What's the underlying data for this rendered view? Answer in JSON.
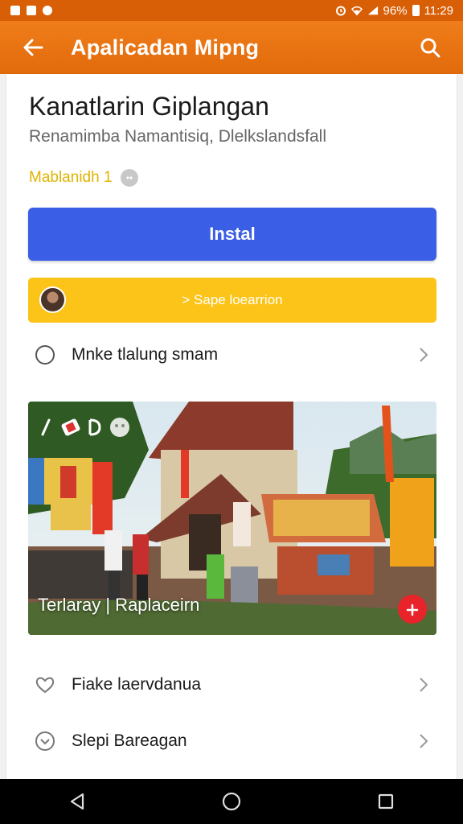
{
  "status_bar": {
    "battery": "96%",
    "time": "11:29",
    "icons": [
      "notification-icon",
      "notification-icon",
      "notification-icon",
      "alarm-icon",
      "wifi-icon",
      "signal-icon",
      "battery-icon"
    ]
  },
  "app_bar": {
    "title": "Apalicadan Mipng",
    "back_icon": "back-arrow-icon",
    "search_icon": "search-icon"
  },
  "app": {
    "title": "Kanatlarin Giplangan",
    "subtitle": "Renamimba Namantisiq, Dlelkslandsfall",
    "rating_label": "Mablanidh 1",
    "install_label": "Instal",
    "secondary_label": "> Sape loearrion",
    "rows": [
      {
        "label": "Mnke tlalung smam",
        "icon": "radio-circle-icon"
      },
      {
        "label": "Fiake laervdanua",
        "icon": "heart-icon"
      },
      {
        "label": "Slepi Bareagan",
        "icon": "heart-check-icon"
      }
    ],
    "hero_caption": "Terlaray | Raplaceirn"
  },
  "colors": {
    "accent": "#e8720c",
    "install": "#3b5ee6",
    "secondary": "#fcc419",
    "rating": "#e0b400"
  }
}
